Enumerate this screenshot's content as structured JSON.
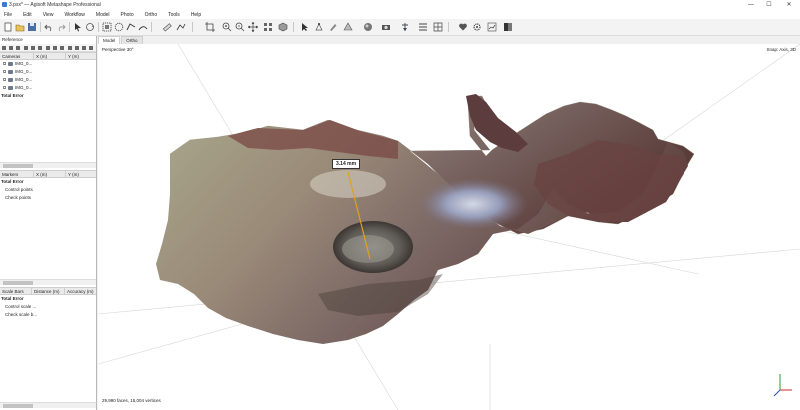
{
  "window": {
    "title": "3.psx* — Agisoft Metashape Professional",
    "minimize": "—",
    "maximize": "☐",
    "close": "✕"
  },
  "menu": [
    "File",
    "Edit",
    "View",
    "Workflow",
    "Model",
    "Photo",
    "Ortho",
    "Tools",
    "Help"
  ],
  "reference": {
    "title": "Reference",
    "cameras_headers": [
      "Cameras",
      "X (m)",
      "Y (m)"
    ],
    "cameras": [
      "IMG_0...",
      "IMG_0...",
      "IMG_0...",
      "IMG_0..."
    ],
    "total_error": "Total Error",
    "markers_headers": [
      "Markers",
      "X (m)",
      "Y (m)"
    ],
    "marker_rows": [
      "Control points",
      "Check points"
    ],
    "scalebar_headers": [
      "Scale Bars",
      "Distance (m)",
      "Accuracy (m)"
    ],
    "scalebar_rows": [
      "Control scale ...",
      "Check scale b..."
    ]
  },
  "viewport": {
    "tabs": [
      "Model",
      "Ortho"
    ],
    "perspective": "Perspective 30°",
    "snap": "Snap: Axis, 3D",
    "measurement": "3.14 mm",
    "stats": "29,990 faces, 15,004 vertices"
  },
  "icons": [
    "new-icon",
    "open-icon",
    "save-icon",
    "undo-icon",
    "redo-icon",
    "navigation-icon",
    "rectangle-select-icon",
    "lasso-icon",
    "ruler-icon",
    "zoom-in-icon",
    "zoom-out-icon",
    "move-icon",
    "rotate-icon",
    "model-view-icon",
    "camera-icon",
    "grid-icon",
    "settings-icon"
  ],
  "colors": {
    "accent": "#3a7bd5",
    "measure_line": "#e0a020"
  }
}
